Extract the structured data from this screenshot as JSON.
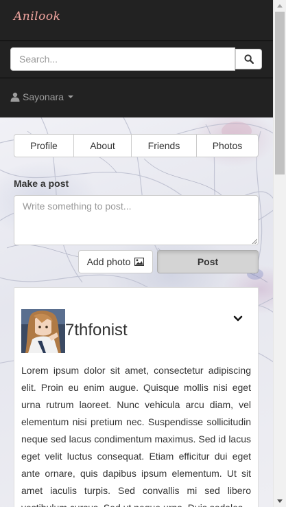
{
  "navbar": {
    "brand": "Anilook",
    "search_placeholder": "Search...",
    "user_name": "Sayonara"
  },
  "tabs": [
    {
      "label": "Profile"
    },
    {
      "label": "About"
    },
    {
      "label": "Friends"
    },
    {
      "label": "Photos"
    }
  ],
  "composer": {
    "heading": "Make a post",
    "placeholder": "Write something to post...",
    "add_photo_label": "Add photo",
    "post_label": "Post"
  },
  "post": {
    "author": "7thfonist",
    "body": "Lorem ipsum dolor sit amet, consectetur adipiscing elit. Proin eu enim augue. Quisque mollis nisi eget urna rutrum laoreet. Nunc vehicula arcu diam, vel elementum nisi pretium nec. Suspendisse sollicitudin neque sed lacus condimentum maximus. Sed id lacus eget velit luctus consequat. Etiam efficitur dui eget ante ornare, quis dapibus ipsum elementum. Ut sit amet iaculis turpis. Sed convallis mi sed libero vestibulum cursus. Sed ut neque urna. Duis sodales"
  },
  "icons": {
    "user": "user-icon",
    "search": "search-icon",
    "photo": "picture-icon",
    "chevron": "chevron-down-icon"
  },
  "colors": {
    "navbar_bg": "#222222",
    "brand": "#e9a7a2",
    "nav_text": "#9d9d9d",
    "post_button_bg": "#d4d4d4"
  }
}
